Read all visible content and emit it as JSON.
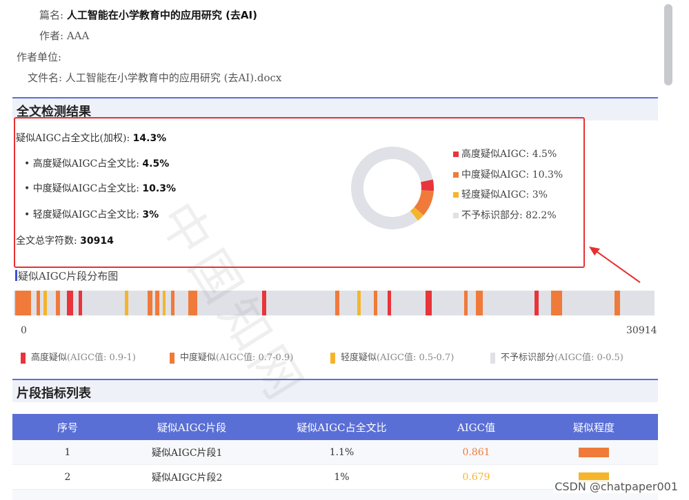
{
  "meta": {
    "title_label": "篇名:",
    "title_value": "人工智能在小学教育中的应用研究 (去AI)",
    "author_label": "作者:",
    "author_value": "AAA",
    "org_label": "作者单位:",
    "file_label": "文件名:",
    "file_value": "人工智能在小学教育中的应用研究 (去AI).docx"
  },
  "results": {
    "section_title": "全文检测结果",
    "overall_label": "疑似AIGC占全文比(加权):",
    "overall_value": "14.3%",
    "high_label": "• 高度疑似AIGC占全文比:",
    "high_value": "4.5%",
    "mid_label": "• 中度疑似AIGC占全文比:",
    "mid_value": "10.3%",
    "low_label": "• 轻度疑似AIGC占全文比:",
    "low_value": "3%",
    "chars_label": "全文总字符数:",
    "chars_value": "30914",
    "legend": [
      {
        "label": "高度疑似AIGC: 4.5%",
        "color": "#e8343b"
      },
      {
        "label": "中度疑似AIGC: 10.3%",
        "color": "#f07a3a"
      },
      {
        "label": "轻度疑似AIGC: 3%",
        "color": "#f4b52c"
      },
      {
        "label": "不予标识部分: 82.2%",
        "color": "#dfe1e6"
      }
    ]
  },
  "chart_data": {
    "type": "pie",
    "categories": [
      "高度疑似AIGC",
      "中度疑似AIGC",
      "轻度疑似AIGC",
      "不予标识部分"
    ],
    "values": [
      4.5,
      10.3,
      3,
      82.2
    ],
    "colors": [
      "#e8343b",
      "#f07a3a",
      "#f4b52c",
      "#dfe1e6"
    ]
  },
  "distribution": {
    "title": "疑似AIGC片段分布图",
    "axis_start": "0",
    "axis_end": "30914",
    "segments": [
      {
        "start": 0.2,
        "end": 2.7,
        "level": "mid"
      },
      {
        "start": 3.5,
        "end": 4.1,
        "level": "mid"
      },
      {
        "start": 4.6,
        "end": 5.2,
        "level": "low"
      },
      {
        "start": 6.6,
        "end": 7.2,
        "level": "mid"
      },
      {
        "start": 8.3,
        "end": 9.3,
        "level": "high"
      },
      {
        "start": 10.1,
        "end": 10.7,
        "level": "high"
      },
      {
        "start": 17.3,
        "end": 17.9,
        "level": "low"
      },
      {
        "start": 20.9,
        "end": 21.6,
        "level": "mid"
      },
      {
        "start": 22.1,
        "end": 22.7,
        "level": "mid"
      },
      {
        "start": 23.2,
        "end": 23.7,
        "level": "low"
      },
      {
        "start": 24.5,
        "end": 25.1,
        "level": "mid"
      },
      {
        "start": 27.2,
        "end": 28.6,
        "level": "mid"
      },
      {
        "start": 38.8,
        "end": 39.4,
        "level": "high"
      },
      {
        "start": 50.2,
        "end": 50.8,
        "level": "mid"
      },
      {
        "start": 53.6,
        "end": 54.1,
        "level": "low"
      },
      {
        "start": 56.2,
        "end": 56.7,
        "level": "mid"
      },
      {
        "start": 58.3,
        "end": 58.9,
        "level": "high"
      },
      {
        "start": 64.3,
        "end": 65.2,
        "level": "high"
      },
      {
        "start": 70.3,
        "end": 70.8,
        "level": "mid"
      },
      {
        "start": 72.1,
        "end": 73.2,
        "level": "mid"
      },
      {
        "start": 81.3,
        "end": 81.9,
        "level": "high"
      },
      {
        "start": 83.8,
        "end": 85.6,
        "level": "mid"
      },
      {
        "start": 93.8,
        "end": 94.6,
        "level": "mid"
      }
    ],
    "legend": [
      {
        "label": "高度疑似",
        "note": "(AIGC值: 0.9-1)",
        "color": "#e8343b"
      },
      {
        "label": "中度疑似",
        "note": "(AIGC值: 0.7-0.9)",
        "color": "#f07a3a"
      },
      {
        "label": "轻度疑似",
        "note": "(AIGC值: 0.5-0.7)",
        "color": "#f4b52c"
      },
      {
        "label": "不予标识部分",
        "note": "(AIGC值: 0-0.5)",
        "color": "#dfe1e6"
      }
    ]
  },
  "table": {
    "section_title": "片段指标列表",
    "headers": [
      "序号",
      "疑似AIGC片段",
      "疑似AIGC占全文比",
      "AIGC值",
      "疑似程度"
    ],
    "rows": [
      {
        "index": "1",
        "segment": "疑似AIGC片段1",
        "ratio": "1.1%",
        "aigc": "0.861",
        "aigc_color": "#f07a3a",
        "level_color": "#f07a3a"
      },
      {
        "index": "2",
        "segment": "疑似AIGC片段2",
        "ratio": "1%",
        "aigc": "0.679",
        "aigc_color": "#f4b52c",
        "level_color": "#f4b52c"
      }
    ]
  },
  "watermark": "中国知网",
  "credit": "CSDN @chatpaper001",
  "colors": {
    "accent": "#5a6fd6",
    "high": "#e8343b",
    "mid": "#f07a3a",
    "low": "#f4b52c",
    "none": "#dfe1e6",
    "highlight": "#e63030"
  }
}
